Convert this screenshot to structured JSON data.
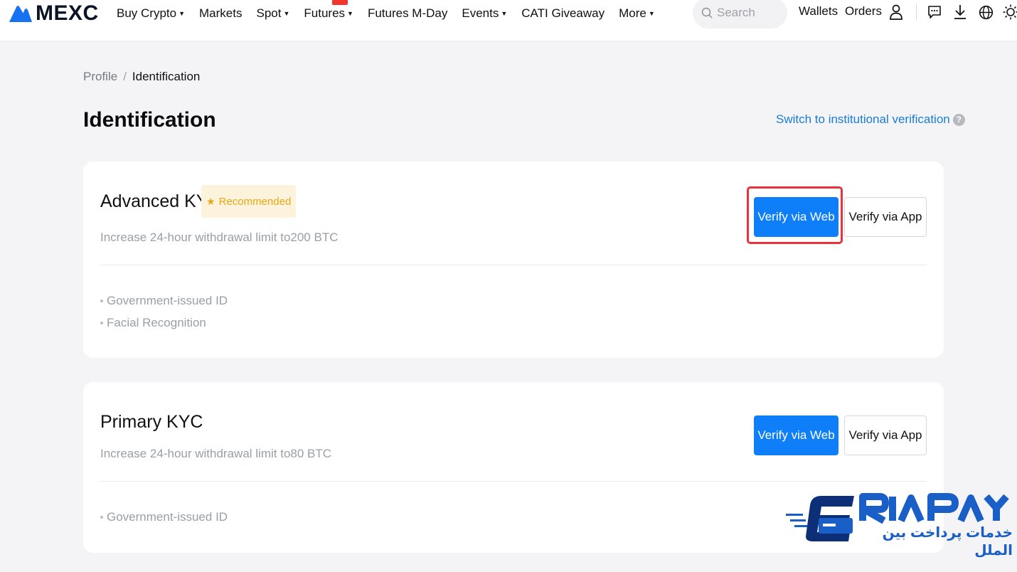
{
  "brand": {
    "name": "MEXC",
    "accent": "#0e7ff8",
    "logo_color": "#1672f0"
  },
  "nav": {
    "items": [
      {
        "label": "Buy Crypto",
        "dropdown": true
      },
      {
        "label": "Markets",
        "dropdown": false
      },
      {
        "label": "Spot",
        "dropdown": true
      },
      {
        "label": "Futures",
        "dropdown": true
      },
      {
        "label": "Futures M-Day",
        "dropdown": false
      },
      {
        "label": "Events",
        "dropdown": true
      },
      {
        "label": "CATI Giveaway",
        "dropdown": false
      },
      {
        "label": "More",
        "dropdown": true
      }
    ],
    "search_placeholder": "Search",
    "wallets": "Wallets",
    "orders": "Orders",
    "icons": [
      "user-icon",
      "chat-icon",
      "download-icon",
      "globe-icon",
      "sun-icon"
    ]
  },
  "breadcrumb": {
    "parent": "Profile",
    "separator": "/",
    "current": "Identification"
  },
  "page": {
    "title": "Identification",
    "switch_link": "Switch to institutional verification",
    "help_glyph": "?"
  },
  "cards": {
    "advanced": {
      "title": "Advanced KYC",
      "badge": "Recommended",
      "badge_color": "#e6a817",
      "subtitle": "Increase 24-hour withdrawal limit to200 BTC",
      "verify_web": "Verify via Web",
      "verify_app": "Verify via App",
      "highlighted_action": "Verify via Web",
      "requirements": [
        "Government-issued ID",
        "Facial Recognition"
      ]
    },
    "primary": {
      "title": "Primary KYC",
      "subtitle": "Increase 24-hour withdrawal limit to80 BTC",
      "verify_web": "Verify via Web",
      "verify_app": "Verify via App",
      "requirements": [
        "Government-issued ID"
      ]
    }
  },
  "watermark": {
    "brand": "ERIAPAY",
    "tagline": "خدمات پرداخت بین الملل",
    "color": "#1a5fc8"
  }
}
